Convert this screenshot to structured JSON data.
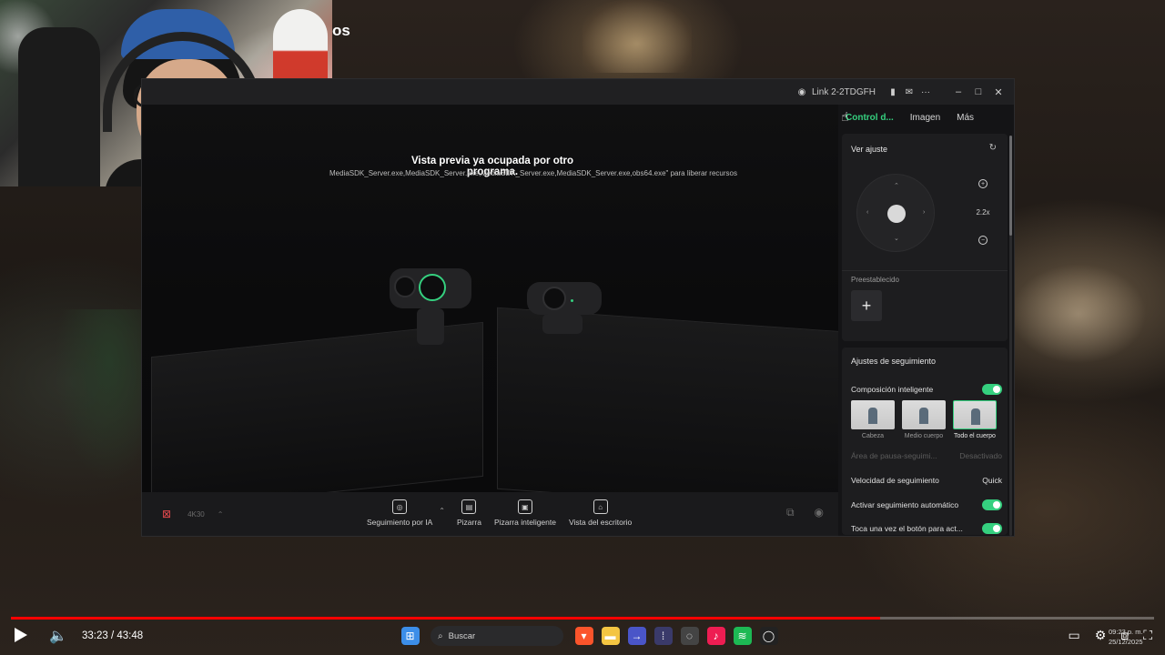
{
  "video_title_fragment": "os",
  "window": {
    "device_name": "Link 2-2TDGFH",
    "more_label": "···",
    "minimize": "–",
    "maximize": "□",
    "close": "✕"
  },
  "preview": {
    "message": "Vista previa ya ocupada por otro programa.",
    "detail": "MediaSDK_Server.exe,MediaSDK_Server.exe,MediaSDK_Server.exe,MediaSDK_Server.exe,obs64.exe\" para liberar recursos"
  },
  "bottom_bar": {
    "resolution": "4K30",
    "tools": [
      {
        "label": "Seguimiento por IA",
        "icon": "ai-tracking-icon"
      },
      {
        "label": "Pizarra",
        "icon": "whiteboard-icon"
      },
      {
        "label": "Pizarra inteligente",
        "icon": "smart-whiteboard-icon"
      },
      {
        "label": "Vista del escritorio",
        "icon": "desk-view-icon"
      }
    ]
  },
  "panel": {
    "tabs": [
      "Control d...",
      "Imagen",
      "Más"
    ],
    "active_tab": "Control d...",
    "view_adjust": "Ver ajuste",
    "zoom_level": "2.2x",
    "preset_label": "Preestablecido",
    "add_preset": "+",
    "tracking_title": "Ajustes de seguimiento",
    "smart_composition": "Composición inteligente",
    "framing": [
      {
        "label": "Cabeza",
        "selected": false
      },
      {
        "label": "Medio cuerpo",
        "selected": false
      },
      {
        "label": "Todo el cuerpo",
        "selected": true
      }
    ],
    "pause_area_label": "Área de pausa-seguimi...",
    "pause_area_value": "Desactivado",
    "tracking_speed_label": "Velocidad de seguimiento",
    "tracking_speed_value": "Quick",
    "auto_tracking_label": "Activar seguimiento automático",
    "tap_button_label": "Toca una vez el botón para act..."
  },
  "player": {
    "time": "33:23 / 43:48",
    "progress_fraction": 0.76,
    "search_placeholder": "Buscar",
    "clock_time": "09:23 p. m.",
    "clock_date": "25/12/2025"
  },
  "colors": {
    "accent": "#35d07f",
    "progress": "#ff0000",
    "camera_off": "#e0484c"
  }
}
